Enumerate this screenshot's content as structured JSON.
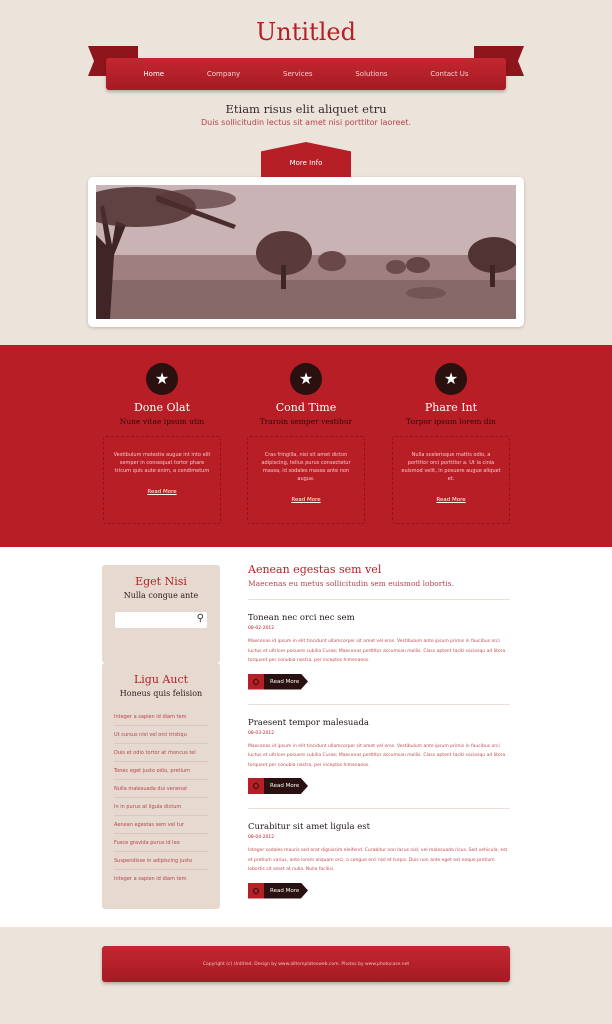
{
  "site": {
    "title": "Untitled"
  },
  "nav": {
    "items": [
      {
        "label": "Home",
        "active": true
      },
      {
        "label": "Company"
      },
      {
        "label": "Services"
      },
      {
        "label": "Solutions"
      },
      {
        "label": "Contact Us"
      }
    ]
  },
  "intro": {
    "heading": "Etiam risus elit aliquet etru",
    "subheading": "Duis sollicitudin lectus sit amet nisi porttitor laoreet.",
    "more_info_label": "More Info"
  },
  "features": [
    {
      "icon": "star-icon",
      "title": "Done Olat",
      "subtitle": "Nune vitae ipsum utin",
      "text": "Vestibulum molestie augue int into elit semper in consequat tortor phare tricum quis aute enim, a condimetum",
      "link": "Read More"
    },
    {
      "icon": "star-icon",
      "title": "Cond Time",
      "subtitle": "Traroin semper vestibur",
      "text": "Cras fringilla, nisi sit amet dicton adipiscing, tellus purus consectetur massa, id sodales massa ante non augue.",
      "link": "Read More"
    },
    {
      "icon": "star-icon",
      "title": "Phare Int",
      "subtitle": "Torpor ipsum lorem din",
      "text": "Nulla scelerisque mattis odio, a porttitor orci porttitor a. Ut la cinia euismod velit, in posuere augue aliquet et.",
      "link": "Read More"
    }
  ],
  "sidebar": {
    "search_box": {
      "title": "Eget Nisi",
      "subtitle": "Nulla congue ante",
      "placeholder": ""
    },
    "links_box": {
      "title": "Ligu Auct",
      "subtitle": "Honeus quis felision",
      "items": [
        "Integer a sapien id diam tem",
        "Ut cursus nisl vel orci tristiqu",
        "Duis et odio tortor at rhoncus tel",
        "Tonec eget justo odio, pretium",
        "Nulla malesuada dui venenat",
        "In in purus at ligula dictum",
        "Aenean egestas sem vel tur",
        "Fusce gravida purus id leo",
        "Suspendisse in adipiscing justo",
        "Integer a sapien id diam tem"
      ]
    }
  },
  "main": {
    "title": "Aenean egestas sem vel",
    "subtitle": "Maecenas eu metus sollicitudin sem euismod lobortis.",
    "posts": [
      {
        "title": "Tonean nec orci nec sem",
        "date": "08-02-2012",
        "body": "Maecenas id ipsum in elit tincidunt ullamcorper sit amet vel eros. Vestibulum ante ipsum primis in faucibus orci luctus et ultrices posuere cubilia Curae; Maecenas porttitor accumsan mollis. Class aptent taciti sociosqu ad litora torquent per conubia nostra, per inceptos himenaeos.",
        "read_more": "Read More"
      },
      {
        "title": "Praesent tempor malesuada",
        "date": "08-03-2012",
        "body": "Maecenas id ipsum in elit tincidunt ullamcorper sit amet vel eros. Vestibulum ante ipsum primis in faucibus orci luctus et ultrices posuere cubilia Curae; Maecenas porttitor accumsan mollis. Class aptent taciti sociosqu ad litora torquent per conubia nostra, per inceptos himenaeos.",
        "read_more": "Read More"
      },
      {
        "title": "Curabitur sit amet ligula est",
        "date": "08-04-2012",
        "body": "Integer sodales mauris sed erat dignissim eleifend. Curabitur non lacus nisl, vel malesuada risus. Sed vehicula, est et pretium varius, ante lorem aliquam orci, a congue orci nisl et turpis. Duis non ante eget est neque pretium lobortis sit amet at nulla. Nulla facilisi.",
        "read_more": "Read More"
      }
    ]
  },
  "footer": {
    "text": "Copyright (c) Untitled. Design by www.alltemplatesweb.com. Photos by www.photocase.net"
  },
  "colors": {
    "brand_red": "#b71f27",
    "dark": "#2a1010",
    "background": "#ece3db"
  }
}
